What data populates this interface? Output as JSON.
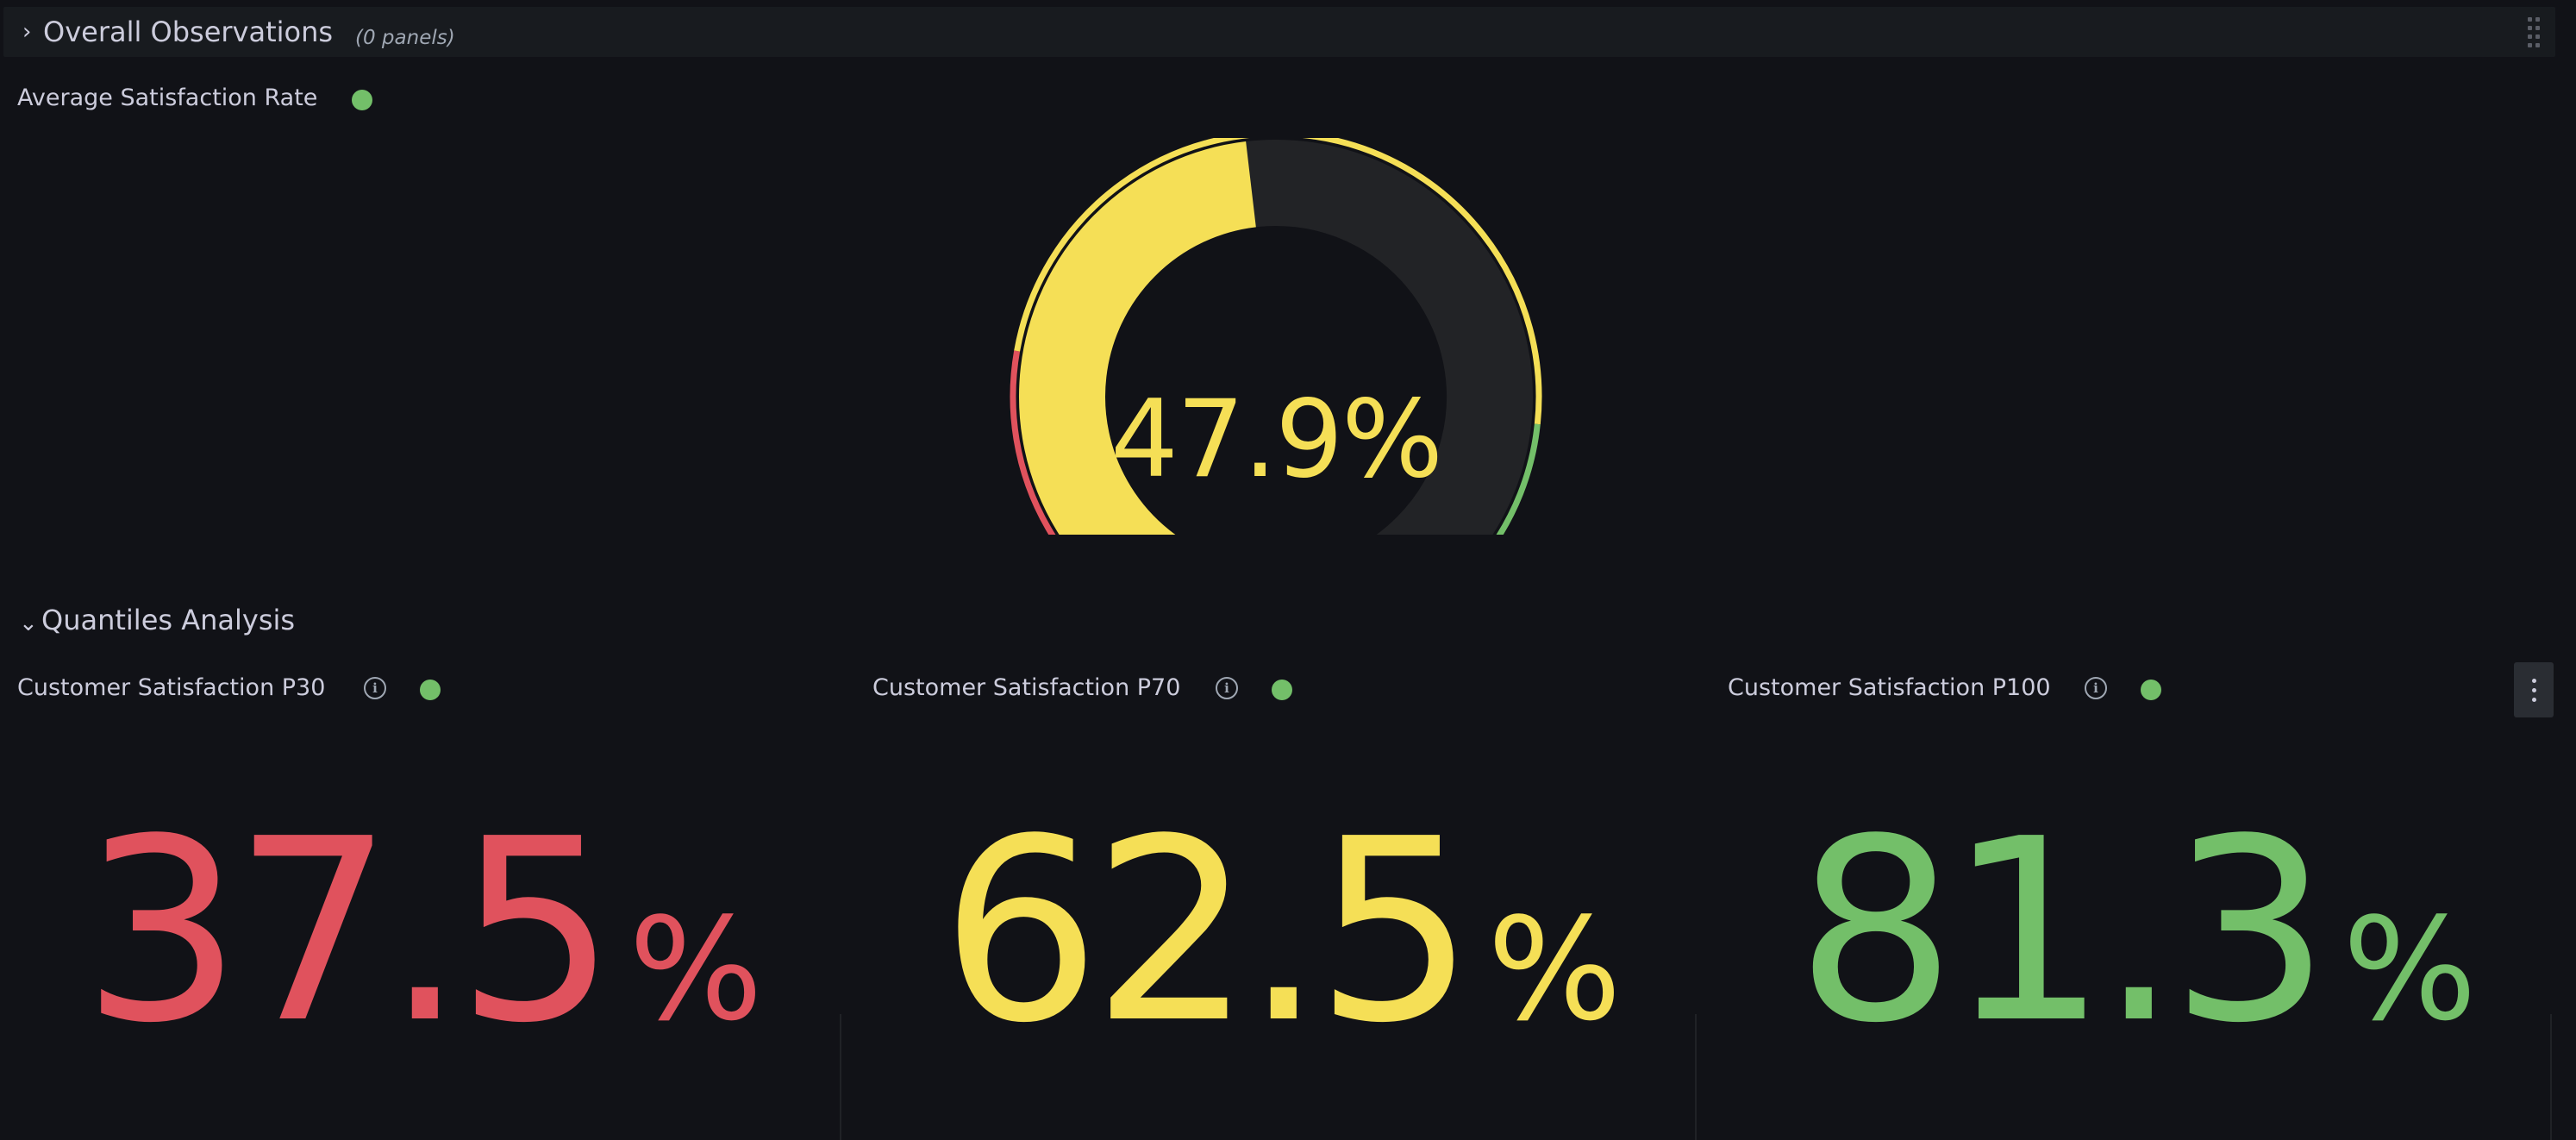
{
  "overall_row": {
    "title": "Overall Observations",
    "panel_count": "(0 panels)",
    "chevron": "chevron-right-icon"
  },
  "gauge_panel": {
    "title": "Average Satisfaction Rate",
    "value": 47.9,
    "display_value": "47.9%",
    "min": 0,
    "max": 100,
    "thresholds": [
      {
        "from": 0,
        "to": 25,
        "color": "#e0525d"
      },
      {
        "from": 25,
        "to": 80,
        "color": "#f5df56"
      },
      {
        "from": 80,
        "to": 100,
        "color": "#73bf69"
      }
    ],
    "value_color": "#f5df56",
    "track_color": "#222326",
    "status": "ok"
  },
  "quantiles_row": {
    "title": "Quantiles Analysis",
    "chevron": "chevron-down-icon"
  },
  "stat_panels": [
    {
      "title": "Customer Satisfaction P30",
      "number": "37.5",
      "unit": "%",
      "color": "#e0525d",
      "status": "ok"
    },
    {
      "title": "Customer Satisfaction P70",
      "number": "62.5",
      "unit": "%",
      "color": "#f5df56",
      "status": "ok"
    },
    {
      "title": "Customer Satisfaction P100",
      "number": "81.3",
      "unit": "%",
      "color": "#73bf69",
      "status": "ok"
    }
  ],
  "colors": {
    "background": "#111217",
    "row_header": "#181b1f",
    "text": "#ccccdc",
    "status_ok": "#73bf69"
  }
}
